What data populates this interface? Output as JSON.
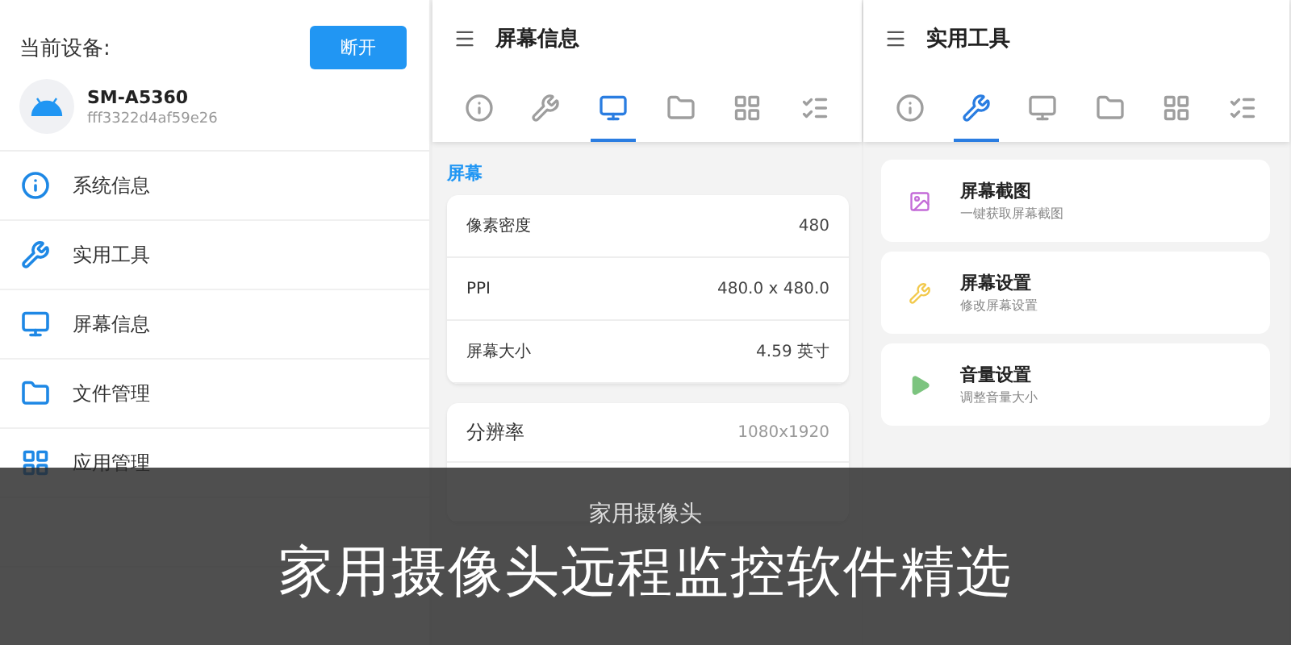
{
  "device_panel": {
    "label": "当前设备:",
    "disconnect_button": "断开",
    "device": {
      "name": "SM-A5360",
      "serial": "fff3322d4af59e26"
    },
    "menu": [
      {
        "label": "系统信息"
      },
      {
        "label": "实用工具"
      },
      {
        "label": "屏幕信息"
      },
      {
        "label": "文件管理"
      },
      {
        "label": "应用管理"
      }
    ]
  },
  "screen_info": {
    "title": "屏幕信息",
    "tabs": [
      {
        "selected": false
      },
      {
        "selected": false
      },
      {
        "selected": true
      },
      {
        "selected": false
      },
      {
        "selected": false
      },
      {
        "selected": false
      }
    ],
    "section": "屏幕",
    "display_rows": [
      {
        "label": "像素密度",
        "value": "480"
      },
      {
        "label": "PPI",
        "value": "480.0 x 480.0"
      },
      {
        "label": "屏幕大小",
        "value": "4.59 英寸"
      }
    ],
    "resolution_rows": [
      {
        "label": "分辨率",
        "value": "1080x1920"
      }
    ]
  },
  "tools": {
    "title": "实用工具",
    "tabs": [
      {
        "selected": false
      },
      {
        "selected": true
      },
      {
        "selected": false
      },
      {
        "selected": false
      },
      {
        "selected": false
      },
      {
        "selected": false
      }
    ],
    "items": [
      {
        "title": "屏幕截图",
        "subtitle": "一键获取屏幕截图"
      },
      {
        "title": "屏幕设置",
        "subtitle": "修改屏幕设置"
      },
      {
        "title": "音量设置",
        "subtitle": "调整音量大小"
      }
    ]
  },
  "overlay": {
    "subtitle": "家用摄像头",
    "headline": "家用摄像头远程监控软件精选"
  }
}
